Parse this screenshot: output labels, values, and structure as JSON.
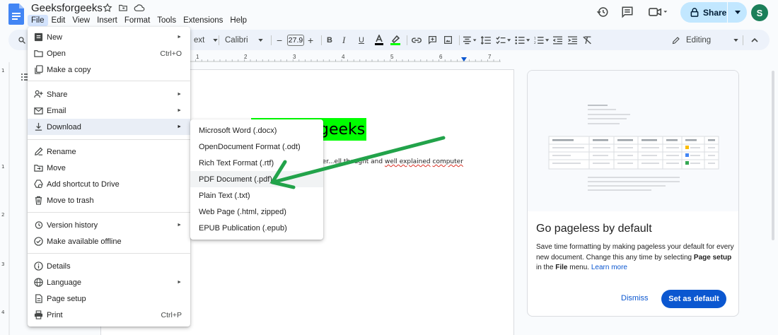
{
  "app": {
    "title": "Geeksforgeeks",
    "menus": [
      "File",
      "Edit",
      "View",
      "Insert",
      "Format",
      "Tools",
      "Extensions",
      "Help"
    ],
    "share_label": "Share",
    "avatar_letter": "S"
  },
  "toolbar": {
    "style_fragment": "ext",
    "font_name": "Calibri",
    "font_size": "27.9",
    "mode_label": "Editing"
  },
  "ruler": {
    "numbers": [
      "1",
      "2",
      "3",
      "4",
      "5",
      "6",
      "7"
    ]
  },
  "document": {
    "heading": "geeks",
    "body_text": "ter...ell thought and ",
    "body_u1": "well explained",
    "body_mid": " ",
    "body_u2": "computer"
  },
  "file_menu": {
    "items": [
      {
        "label": "New",
        "icon": "new-doc-icon",
        "shortcut": "",
        "submenu": true
      },
      {
        "label": "Open",
        "icon": "folder-icon",
        "shortcut": "Ctrl+O",
        "submenu": false
      },
      {
        "label": "Make a copy",
        "icon": "copy-icon",
        "shortcut": "",
        "submenu": false
      },
      {
        "label": "Share",
        "icon": "person-add-icon",
        "shortcut": "",
        "submenu": true
      },
      {
        "label": "Email",
        "icon": "mail-icon",
        "shortcut": "",
        "submenu": true
      },
      {
        "label": "Download",
        "icon": "download-icon",
        "shortcut": "",
        "submenu": true
      },
      {
        "label": "Rename",
        "icon": "pencil-icon",
        "shortcut": "",
        "submenu": false
      },
      {
        "label": "Move",
        "icon": "move-folder-icon",
        "shortcut": "",
        "submenu": false
      },
      {
        "label": "Add shortcut to Drive",
        "icon": "drive-shortcut-icon",
        "shortcut": "",
        "submenu": false
      },
      {
        "label": "Move to trash",
        "icon": "trash-icon",
        "shortcut": "",
        "submenu": false
      },
      {
        "label": "Version history",
        "icon": "history-icon",
        "shortcut": "",
        "submenu": true
      },
      {
        "label": "Make available offline",
        "icon": "offline-icon",
        "shortcut": "",
        "submenu": false
      },
      {
        "label": "Details",
        "icon": "info-icon",
        "shortcut": "",
        "submenu": false
      },
      {
        "label": "Language",
        "icon": "globe-icon",
        "shortcut": "",
        "submenu": true
      },
      {
        "label": "Page setup",
        "icon": "page-icon",
        "shortcut": "",
        "submenu": false
      },
      {
        "label": "Print",
        "icon": "print-icon",
        "shortcut": "Ctrl+P",
        "submenu": false
      }
    ]
  },
  "download_submenu": {
    "items": [
      "Microsoft Word (.docx)",
      "OpenDocument Format (.odt)",
      "Rich Text Format (.rtf)",
      "PDF Document (.pdf)",
      "Plain Text (.txt)",
      "Web Page (.html, zipped)",
      "EPUB Publication (.epub)"
    ]
  },
  "side_panel": {
    "title": "Go pageless by default",
    "desc_1": "Save time formatting by making pageless your default for every new document. Change this any time by selecting ",
    "desc_bold_1": "Page setup",
    "desc_2": " in the ",
    "desc_bold_2": "File",
    "desc_3": " menu. ",
    "desc_link": "Learn more",
    "dismiss_label": "Dismiss",
    "default_label": "Set as default"
  },
  "colors": {
    "accent": "#0b57d0",
    "highlight": "#00ff00",
    "arrow": "#22a34a",
    "avatar": "#1b7f5a"
  }
}
